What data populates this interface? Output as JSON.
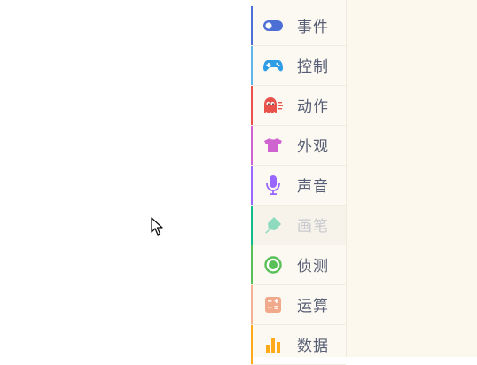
{
  "categories": [
    {
      "label": "事件",
      "icon": "toggle-icon",
      "color": "#4c6fd6",
      "bar": "#4c6fd6"
    },
    {
      "label": "控制",
      "icon": "gamepad-icon",
      "color": "#2f9ce6",
      "bar": "#5cb8e8"
    },
    {
      "label": "动作",
      "icon": "ghost-icon",
      "color": "#e8524a",
      "bar": "#e8524a"
    },
    {
      "label": "外观",
      "icon": "tshirt-icon",
      "color": "#cf63cf",
      "bar": "#cf63cf"
    },
    {
      "label": "声音",
      "icon": "microphone-icon",
      "color": "#9966ff",
      "bar": "#9966ff"
    },
    {
      "label": "画笔",
      "icon": "pen-icon",
      "color": "#0fbd8c",
      "bar": "#0fbd8c"
    },
    {
      "label": "侦测",
      "icon": "radar-icon",
      "color": "#59c059",
      "bar": "#59c059"
    },
    {
      "label": "运算",
      "icon": "calculator-icon",
      "color": "#f0a98a",
      "bar": "#f3b293"
    },
    {
      "label": "数据",
      "icon": "bar-chart-icon",
      "color": "#ffab19",
      "bar": "#ffab19"
    }
  ]
}
